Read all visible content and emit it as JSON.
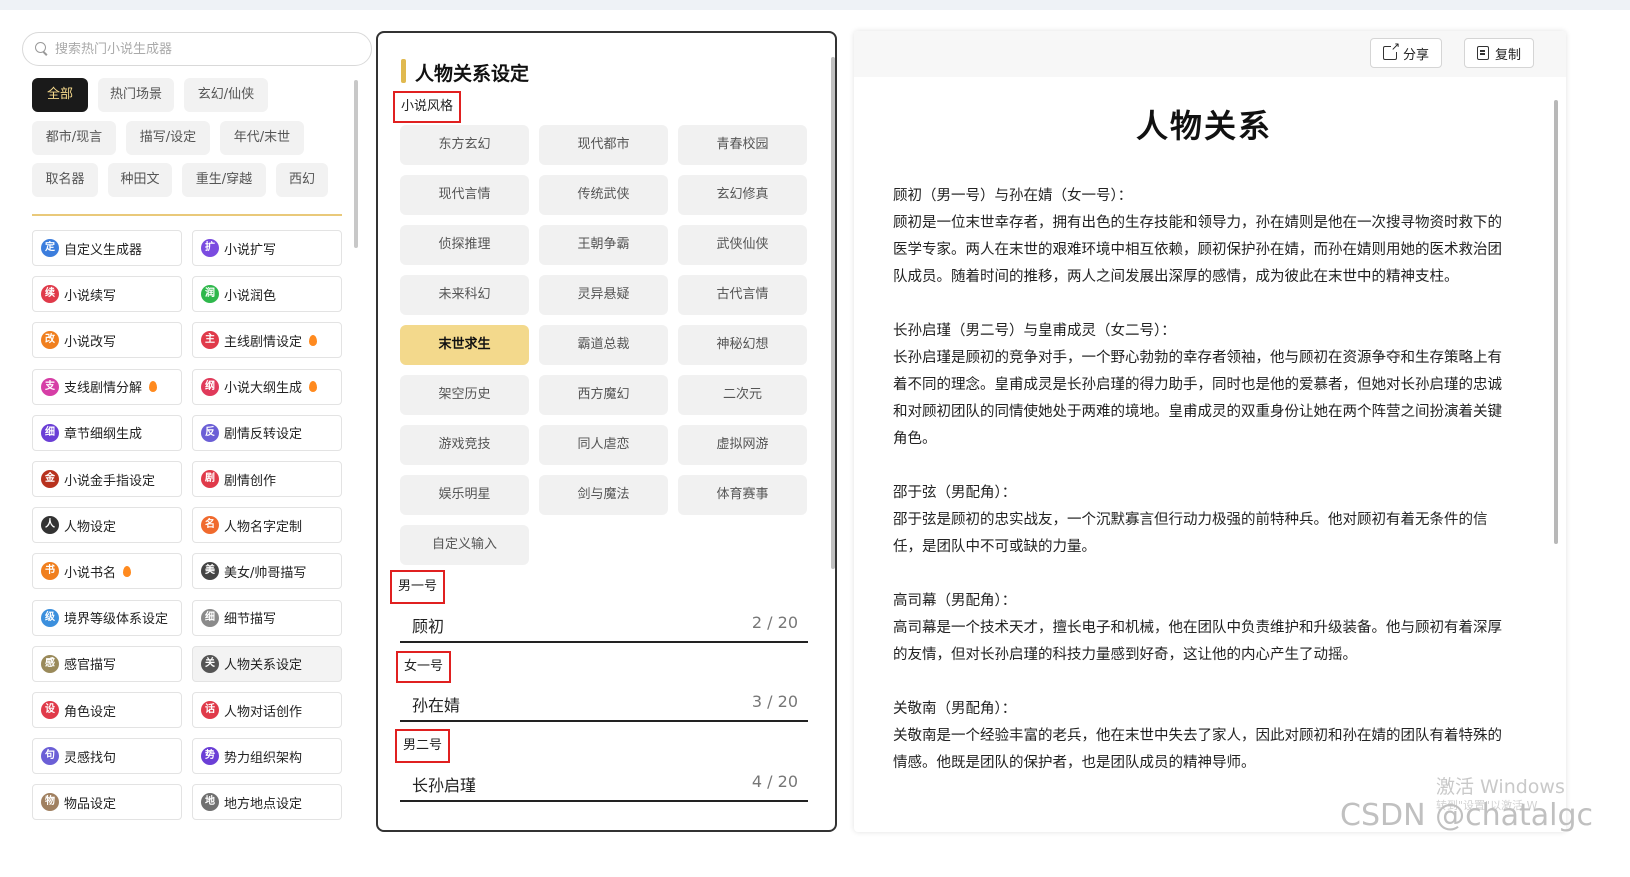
{
  "search": {
    "placeholder": "搜索热门小说生成器"
  },
  "categories": [
    "全部",
    "热门场景",
    "玄幻/仙侠",
    "都市/现言",
    "描写/设定",
    "年代/末世",
    "取名器",
    "种田文",
    "重生/穿越",
    "西幻"
  ],
  "active_category": "全部",
  "tools": [
    {
      "label": "自定义生成器",
      "icon": "custom-icon",
      "glyph": "定",
      "color": "#3b7ddd",
      "hot": false
    },
    {
      "label": "小说扩写",
      "icon": "expand-icon",
      "glyph": "扩",
      "color": "#7a4be0",
      "hot": false
    },
    {
      "label": "小说续写",
      "icon": "continue-icon",
      "glyph": "续",
      "color": "#e03a4a",
      "hot": false
    },
    {
      "label": "小说润色",
      "icon": "polish-icon",
      "glyph": "润",
      "color": "#2fb84c",
      "hot": false
    },
    {
      "label": "小说改写",
      "icon": "rewrite-icon",
      "glyph": "改",
      "color": "#f07f1e",
      "hot": false
    },
    {
      "label": "主线剧情设定",
      "icon": "main-plot-icon",
      "glyph": "主",
      "color": "#e03a4a",
      "hot": true
    },
    {
      "label": "支线剧情分解",
      "icon": "subplot-icon",
      "glyph": "支",
      "color": "#d63ea6",
      "hot": true
    },
    {
      "label": "小说大纲生成",
      "icon": "outline-icon",
      "glyph": "纲",
      "color": "#e03a5a",
      "hot": true
    },
    {
      "label": "章节细纲生成",
      "icon": "chapter-outline-icon",
      "glyph": "细",
      "color": "#6b3fd6",
      "hot": false
    },
    {
      "label": "剧情反转设定",
      "icon": "plot-twist-icon",
      "glyph": "反",
      "color": "#6b5fd6",
      "hot": false
    },
    {
      "label": "小说金手指设定",
      "icon": "golden-finger-icon",
      "glyph": "金",
      "color": "#b8321e",
      "hot": false
    },
    {
      "label": "剧情创作",
      "icon": "plot-create-icon",
      "glyph": "剧",
      "color": "#e03a4a",
      "hot": false
    },
    {
      "label": "人物设定",
      "icon": "character-icon",
      "glyph": "人",
      "color": "#333333",
      "hot": false
    },
    {
      "label": "人物名字定制",
      "icon": "name-custom-icon",
      "glyph": "名",
      "color": "#f06a2e",
      "hot": false
    },
    {
      "label": "小说书名",
      "icon": "book-title-icon",
      "glyph": "书",
      "color": "#f07f1e",
      "hot": true
    },
    {
      "label": "美女/帅哥描写",
      "icon": "beauty-icon",
      "glyph": "美",
      "color": "#444444",
      "hot": false
    },
    {
      "label": "境界等级体系设定",
      "icon": "realm-level-icon",
      "glyph": "级",
      "color": "#3b8fdd",
      "hot": false
    },
    {
      "label": "细节描写",
      "icon": "detail-icon",
      "glyph": "细",
      "color": "#8a8a8a",
      "hot": false
    },
    {
      "label": "感官描写",
      "icon": "senses-icon",
      "glyph": "感",
      "color": "#9a8a5a",
      "hot": false
    },
    {
      "label": "人物关系设定",
      "icon": "relationship-icon",
      "glyph": "关",
      "color": "#555555",
      "hot": false
    },
    {
      "label": "角色设定",
      "icon": "role-icon",
      "glyph": "设",
      "color": "#e03a4a",
      "hot": false
    },
    {
      "label": "人物对话创作",
      "icon": "dialogue-icon",
      "glyph": "话",
      "color": "#e03a4a",
      "hot": false
    },
    {
      "label": "灵感找句",
      "icon": "inspiration-icon",
      "glyph": "句",
      "color": "#6b5fd6",
      "hot": false
    },
    {
      "label": "势力组织架构",
      "icon": "faction-icon",
      "glyph": "势",
      "color": "#6b3fd6",
      "hot": false
    },
    {
      "label": "物品设定",
      "icon": "item-icon",
      "glyph": "物",
      "color": "#a08060",
      "hot": false
    },
    {
      "label": "地方地点设定",
      "icon": "location-icon",
      "glyph": "地",
      "color": "#707070",
      "hot": false
    }
  ],
  "selected_tool": "人物关系设定",
  "form": {
    "title": "人物关系设定",
    "style_label": "小说风格",
    "styles": [
      "东方玄幻",
      "现代都市",
      "青春校园",
      "现代言情",
      "传统武侠",
      "玄幻修真",
      "侦探推理",
      "王朝争霸",
      "武侠仙侠",
      "未来科幻",
      "灵异悬疑",
      "古代言情",
      "末世求生",
      "霸道总裁",
      "神秘幻想",
      "架空历史",
      "西方魔幻",
      "二次元",
      "游戏竞技",
      "同人虐恋",
      "虚拟网游",
      "娱乐明星",
      "剑与魔法",
      "体育赛事",
      "自定义输入"
    ],
    "selected_style": "末世求生",
    "fields": [
      {
        "label": "男一号",
        "value": "顾初",
        "count": "2 / 20"
      },
      {
        "label": "女一号",
        "value": "孙在婧",
        "count": "3 / 20"
      },
      {
        "label": "男二号",
        "value": "长孙启瑾",
        "count": "4 / 20"
      }
    ]
  },
  "result": {
    "share_label": "分享",
    "copy_label": "复制",
    "title": "人物关系",
    "sections": [
      {
        "heading": "顾初（男一号）与孙在婧（女一号）：",
        "text": "顾初是一位末世幸存者，拥有出色的生存技能和领导力，孙在婧则是他在一次搜寻物资时救下的医学专家。两人在末世的艰难环境中相互依赖，顾初保护孙在婧，而孙在婧则用她的医术救治团队成员。随着时间的推移，两人之间发展出深厚的感情，成为彼此在末世中的精神支柱。"
      },
      {
        "heading": "长孙启瑾（男二号）与皇甫成灵（女二号）：",
        "text": "长孙启瑾是顾初的竞争对手，一个野心勃勃的幸存者领袖，他与顾初在资源争夺和生存策略上有着不同的理念。皇甫成灵是长孙启瑾的得力助手，同时也是他的爱慕者，但她对长孙启瑾的忠诚和对顾初团队的同情使她处于两难的境地。皇甫成灵的双重身份让她在两个阵营之间扮演着关键角色。"
      },
      {
        "heading": "邵于弦（男配角）：",
        "text": "邵于弦是顾初的忠实战友，一个沉默寡言但行动力极强的前特种兵。他对顾初有着无条件的信任，是团队中不可或缺的力量。"
      },
      {
        "heading": "高司幕（男配角）：",
        "text": "高司幕是一个技术天才，擅长电子和机械，他在团队中负责维护和升级装备。他与顾初有着深厚的友情，但对长孙启瑾的科技力量感到好奇，这让他的内心产生了动摇。"
      },
      {
        "heading": "关敬南（男配角）：",
        "text": "关敬南是一个经验丰富的老兵，他在末世中失去了家人，因此对顾初和孙在婧的团队有着特殊的情感。他既是团队的保护者，也是团队成员的精神导师。"
      }
    ]
  },
  "overlay": {
    "activate_windows": "激活 Windows",
    "activate_hint": "转到\"设置\"以激活 W",
    "csdn": "CSDN @chatalgc"
  }
}
